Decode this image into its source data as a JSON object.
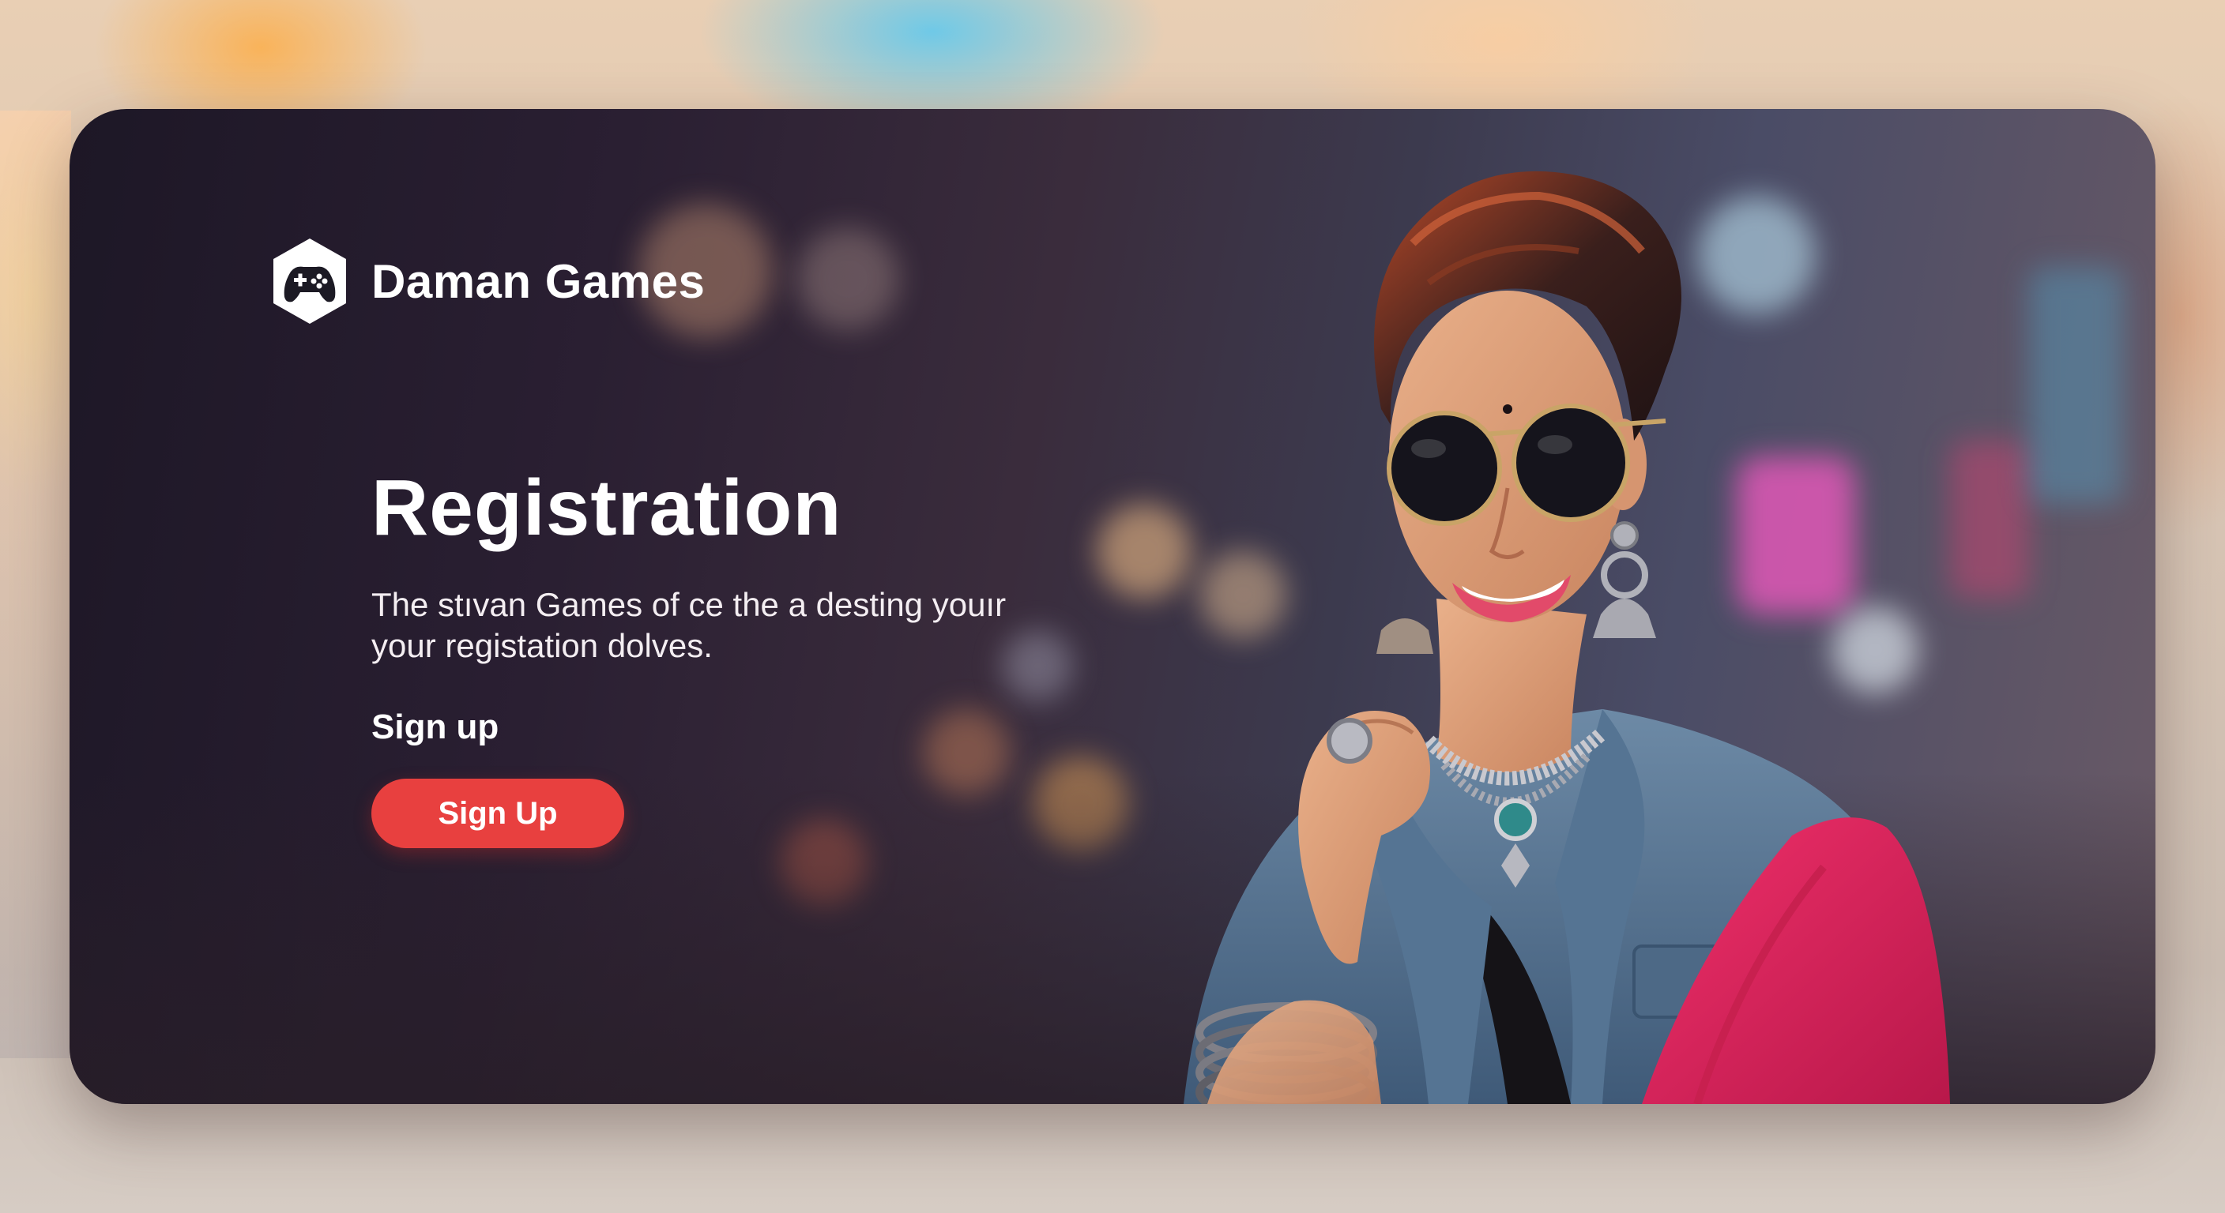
{
  "brand": {
    "name": "Daman Games",
    "accent_color": "#e8403f",
    "icon": "gamepad-icon"
  },
  "hero": {
    "title": "Registration",
    "description": "The stıvan Games of ce the a desting youır your registation dolves.",
    "subheading": "Sign up",
    "button_label": "Sign Up"
  },
  "illustration": {
    "subject": "woman-with-sunglasses-illustration"
  }
}
